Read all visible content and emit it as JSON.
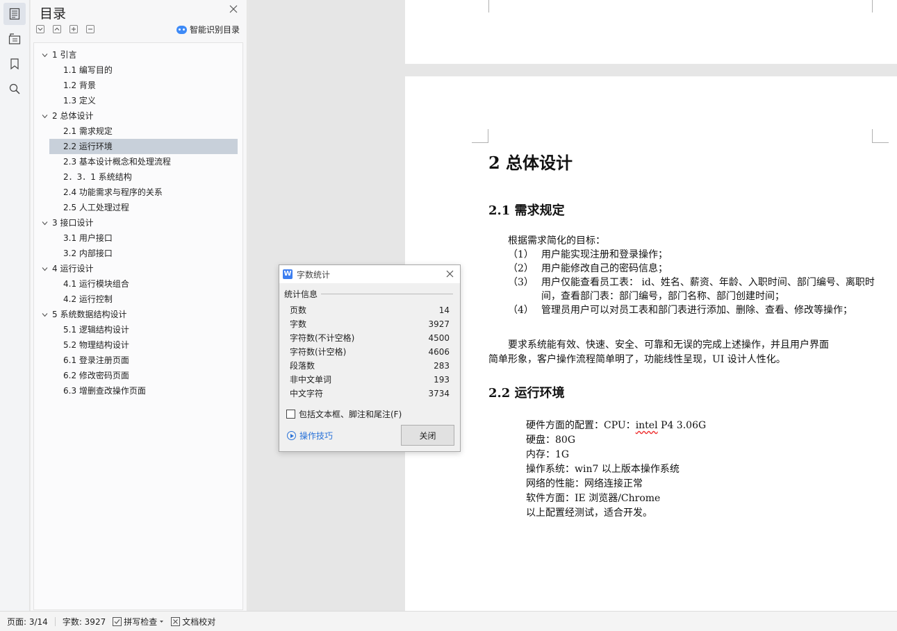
{
  "sidebar_rail": {
    "icons": [
      "toc-icon",
      "navigation-icon",
      "bookmark-icon",
      "search-icon"
    ]
  },
  "toc": {
    "title": "目录",
    "smart_label": "智能识别目录",
    "items": [
      {
        "level": 1,
        "text": "1 引言"
      },
      {
        "level": 2,
        "text": "1.1 编写目的"
      },
      {
        "level": 2,
        "text": "1.2 背景"
      },
      {
        "level": 2,
        "text": "1.3 定义"
      },
      {
        "level": 1,
        "text": "2 总体设计"
      },
      {
        "level": 2,
        "text": "2.1 需求规定"
      },
      {
        "level": 2,
        "text": "2.2 运行环境",
        "selected": true
      },
      {
        "level": 2,
        "text": "2.3 基本设计概念和处理流程"
      },
      {
        "level": 2,
        "text": "2．3．1 系统结构"
      },
      {
        "level": 2,
        "text": "2.4 功能需求与程序的关系"
      },
      {
        "level": 2,
        "text": "2.5 人工处理过程"
      },
      {
        "level": 1,
        "text": "3 接口设计"
      },
      {
        "level": 2,
        "text": "3.1 用户接口"
      },
      {
        "level": 2,
        "text": "3.2 内部接口"
      },
      {
        "level": 1,
        "text": "4 运行设计"
      },
      {
        "level": 2,
        "text": "4.1 运行模块组合"
      },
      {
        "level": 2,
        "text": "4.2 运行控制"
      },
      {
        "level": 1,
        "text": "5 系统数据结构设计"
      },
      {
        "level": 2,
        "text": "5.1 逻辑结构设计"
      },
      {
        "level": 2,
        "text": "5.2  物理结构设计"
      },
      {
        "level": 2,
        "text": "6.1 登录注册页面"
      },
      {
        "level": 2,
        "text": "6.2 修改密码页面"
      },
      {
        "level": 2,
        "text": "6.3 增删查改操作页面"
      }
    ]
  },
  "document": {
    "h1": "2 总体设计",
    "sec1_title": "2.1 需求规定",
    "sec1_intro": "根据需求简化的目标：",
    "requirements": [
      {
        "num": "（1）",
        "text": "用户能实现注册和登录操作；"
      },
      {
        "num": "（2）",
        "text": "用户能修改自己的密码信息；"
      },
      {
        "num": "（3）",
        "text": "用户仅能查看员工表： id、姓名、薪资、年龄、入职时间、部门编号、离职时间，查看部门表：部门编号，部门名称、部门创建时间；"
      },
      {
        "num": "（4）",
        "text": "管理员用户可以对员工表和部门表进行添加、删除、查看、修改等操作；"
      }
    ],
    "sec1_summary_1": "要求系统能有效、快速、安全、可靠和无误的完成上述操作，并且用户界面",
    "sec1_summary_2": "简单形象，客户操作流程简单明了，功能线性呈现，UI 设计人性化。",
    "sec2_title": "2.2 运行环境",
    "env": {
      "hw_prefix": "硬件方面的配置：CPU：",
      "hw_cpu_underlined": "intel",
      "hw_cpu_rest": " P4 3.06G",
      "disk": "硬盘：80G",
      "memory": "内存：1G",
      "os": "操作系统：win7 以上版本操作系统",
      "network": "网络的性能：网络连接正常",
      "software": "软件方面：IE 浏览器/Chrome",
      "conclusion": "以上配置经测试，适合开发。"
    }
  },
  "dialog": {
    "title": "字数统计",
    "section": "统计信息",
    "stats": [
      {
        "label": "页数",
        "value": "14"
      },
      {
        "label": "字数",
        "value": "3927"
      },
      {
        "label": "字符数(不计空格)",
        "value": "4500"
      },
      {
        "label": "字符数(计空格)",
        "value": "4606"
      },
      {
        "label": "段落数",
        "value": "283"
      },
      {
        "label": "非中文单词",
        "value": "193"
      },
      {
        "label": "中文字符",
        "value": "3734"
      }
    ],
    "checkbox_label": "包括文本框、脚注和尾注(F)",
    "checkbox_checked": false,
    "tips_label": "操作技巧",
    "close_label": "关闭"
  },
  "status_bar": {
    "page": "页面: 3/14",
    "word_count": "字数: 3927",
    "spell_check": "拼写检查",
    "proofread": "文档校对"
  },
  "colors": {
    "accent": "#3d7ef0",
    "toc_selected": "#c8d0da",
    "link": "#2a72d8"
  }
}
